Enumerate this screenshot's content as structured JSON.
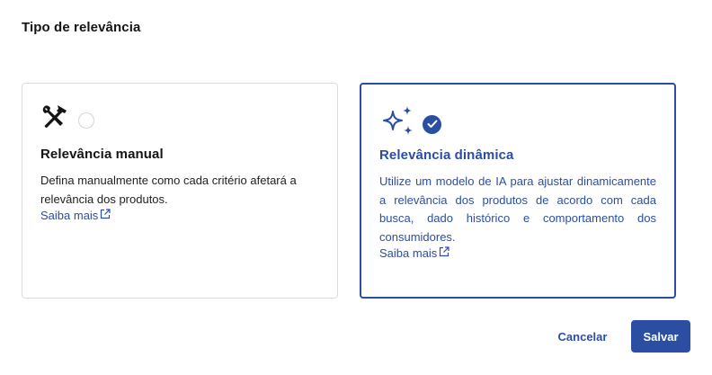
{
  "section": {
    "title": "Tipo de relevância"
  },
  "options": {
    "manual": {
      "heading": "Relevância manual",
      "description": "Defina manualmente como cada critério afetará a relevância dos produtos.",
      "link_label": "Saiba mais",
      "icon": "tools-icon",
      "selected": false
    },
    "dynamic": {
      "heading": "Relevância dinâmica",
      "description": "Utilize um modelo de IA para ajustar dinamicamente a relevância dos produtos de acordo com cada busca, dado histórico e comportamento dos consumidores.",
      "link_label": "Saiba mais",
      "icon": "sparkles-icon",
      "selected": true
    }
  },
  "actions": {
    "cancel_label": "Cancelar",
    "save_label": "Salvar"
  },
  "colors": {
    "accent": "#2b4ea2",
    "border": "#dcdcdc",
    "text": "#141414"
  }
}
